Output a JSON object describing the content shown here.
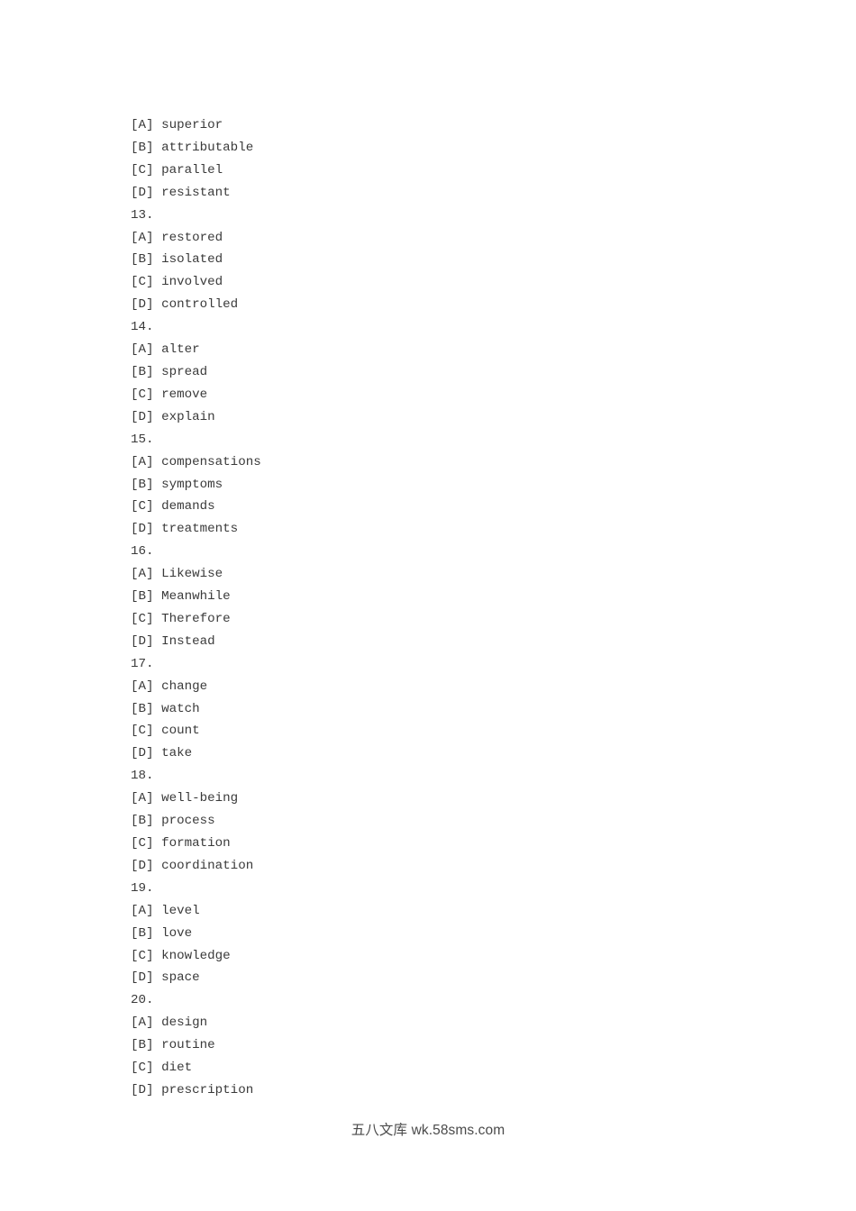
{
  "document": {
    "kind": "exam-answer-options-page",
    "page_background": "#ffffff",
    "text_color": "#3a3a3a",
    "watermark_color": "#4a4a4a"
  },
  "question_blocks": [
    {
      "number": "",
      "options": [
        {
          "tag": "[A]",
          "text": "superior"
        },
        {
          "tag": "[B]",
          "text": "attributable"
        },
        {
          "tag": "[C]",
          "text": "parallel"
        },
        {
          "tag": "[D]",
          "text": "resistant"
        }
      ]
    },
    {
      "number": "13.",
      "options": [
        {
          "tag": "[A]",
          "text": "restored"
        },
        {
          "tag": "[B]",
          "text": "isolated"
        },
        {
          "tag": "[C]",
          "text": "involved"
        },
        {
          "tag": "[D]",
          "text": "controlled"
        }
      ]
    },
    {
      "number": "14.",
      "options": [
        {
          "tag": "[A]",
          "text": "alter"
        },
        {
          "tag": "[B]",
          "text": "spread"
        },
        {
          "tag": "[C]",
          "text": "remove"
        },
        {
          "tag": "[D]",
          "text": "explain"
        }
      ]
    },
    {
      "number": "15.",
      "options": [
        {
          "tag": "[A]",
          "text": "compensations"
        },
        {
          "tag": "[B]",
          "text": "symptoms"
        },
        {
          "tag": "[C]",
          "text": "demands"
        },
        {
          "tag": "[D]",
          "text": "treatments"
        }
      ]
    },
    {
      "number": "16.",
      "options": [
        {
          "tag": "[A]",
          "text": "Likewise"
        },
        {
          "tag": "[B]",
          "text": "Meanwhile"
        },
        {
          "tag": "[C]",
          "text": "Therefore"
        },
        {
          "tag": "[D]",
          "text": "Instead"
        }
      ]
    },
    {
      "number": "17.",
      "options": [
        {
          "tag": "[A]",
          "text": "change"
        },
        {
          "tag": "[B]",
          "text": "watch"
        },
        {
          "tag": "[C]",
          "text": "count"
        },
        {
          "tag": "[D]",
          "text": "take"
        }
      ]
    },
    {
      "number": "18.",
      "options": [
        {
          "tag": "[A]",
          "text": "well-being"
        },
        {
          "tag": "[B]",
          "text": "process"
        },
        {
          "tag": "[C]",
          "text": "formation"
        },
        {
          "tag": "[D]",
          "text": "coordination"
        }
      ]
    },
    {
      "number": "19.",
      "options": [
        {
          "tag": "[A]",
          "text": "level"
        },
        {
          "tag": "[B]",
          "text": "love"
        },
        {
          "tag": "[C]",
          "text": "knowledge"
        },
        {
          "tag": "[D]",
          "text": "space"
        }
      ]
    },
    {
      "number": "20.",
      "options": [
        {
          "tag": "[A]",
          "text": "design"
        },
        {
          "tag": "[B]",
          "text": "routine"
        },
        {
          "tag": "[C]",
          "text": "diet"
        },
        {
          "tag": "[D]",
          "text": "prescription"
        }
      ]
    }
  ],
  "watermark": {
    "chinese": "五八文库",
    "url": "wk.58sms.com",
    "full": "五八文库 wk.58sms.com"
  }
}
